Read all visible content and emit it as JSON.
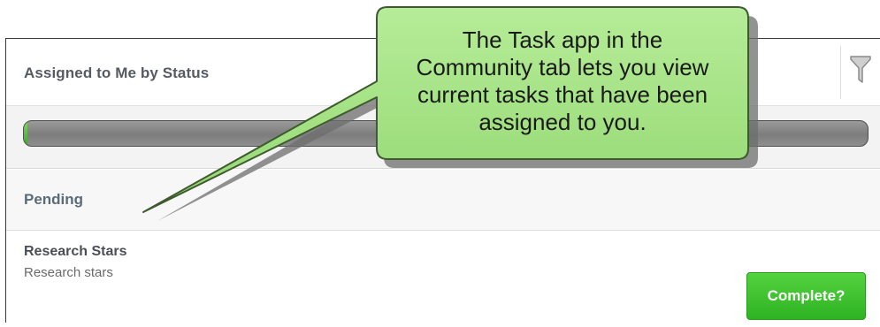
{
  "widget": {
    "title": "Assigned to Me by Status",
    "filter_icon": "funnel-icon",
    "progress": 0.003,
    "progress_color": "#3aa326"
  },
  "status_group": {
    "label": "Pending"
  },
  "task": {
    "title": "Research Stars",
    "description": "Research stars",
    "complete_label": "Complete?",
    "complete_color": "#2eb322"
  },
  "callout": {
    "lines": [
      "The Task app in the",
      "Community tab lets you view",
      "current tasks that have been",
      "assigned to you."
    ],
    "fill_color": "#a6e283"
  }
}
